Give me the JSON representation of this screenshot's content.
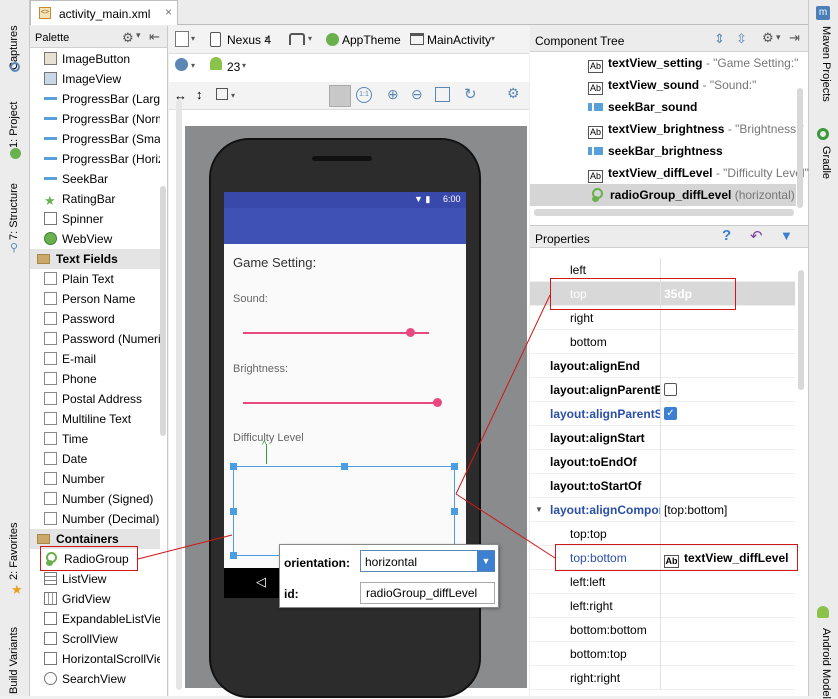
{
  "editor": {
    "tab_label": "activity_main.xml"
  },
  "left_strip": {
    "tabs": [
      "Captures",
      "1: Project",
      "7: Structure",
      "2: Favorites",
      "Build Variants"
    ]
  },
  "right_strip": {
    "tabs": [
      "Maven Projects",
      "Gradle",
      "Android Model"
    ]
  },
  "palette": {
    "title": "Palette",
    "items_top": [
      "ImageButton",
      "ImageView",
      "ProgressBar (Large)",
      "ProgressBar (Normal)",
      "ProgressBar (Small)",
      "ProgressBar (Horizontal)",
      "SeekBar",
      "RatingBar",
      "Spinner",
      "WebView"
    ],
    "group_text_fields": "Text Fields",
    "text_fields": [
      "Plain Text",
      "Person Name",
      "Password",
      "Password (Numeric)",
      "E-mail",
      "Phone",
      "Postal Address",
      "Multiline Text",
      "Time",
      "Date",
      "Number",
      "Number (Signed)",
      "Number (Decimal)"
    ],
    "group_containers": "Containers",
    "containers": [
      "RadioGroup",
      "ListView",
      "GridView",
      "ExpandableListView",
      "ScrollView",
      "HorizontalScrollView",
      "SearchView"
    ]
  },
  "toolbar": {
    "device": "Nexus 4",
    "theme": "AppTheme",
    "activity": "MainActivity",
    "api": "23"
  },
  "device_screen": {
    "time": "6:00",
    "title": "Game Setting:",
    "sound_label": "Sound:",
    "brightness_label": "Brightness:",
    "difficulty_label": "Difficulty Level",
    "sound_progress": 0.9,
    "brightness_progress": 0.95
  },
  "popup": {
    "orientation_label": "orientation:",
    "orientation_value": "horizontal",
    "id_label": "id:",
    "id_value": "radioGroup_diffLevel"
  },
  "component_tree": {
    "title": "Component Tree",
    "items": [
      {
        "icon": "Ab",
        "name": "textView_setting",
        "detail": "- \"Game Setting:\""
      },
      {
        "icon": "Ab",
        "name": "textView_sound",
        "detail": "- \"Sound:\""
      },
      {
        "icon": "seek",
        "name": "seekBar_sound",
        "detail": ""
      },
      {
        "icon": "Ab",
        "name": "textView_brightness",
        "detail": "- \"Brightness:\""
      },
      {
        "icon": "seek",
        "name": "seekBar_brightness",
        "detail": ""
      },
      {
        "icon": "Ab",
        "name": "textView_diffLevel",
        "detail": "- \"Difficulty Level\""
      },
      {
        "icon": "radio",
        "name": "radioGroup_diffLevel",
        "detail": "(horizontal)"
      }
    ]
  },
  "properties": {
    "title": "Properties",
    "rows": [
      {
        "name": "left",
        "value": "",
        "indent": true,
        "bold": false
      },
      {
        "name": "top",
        "value": "35dp",
        "indent": true,
        "bold": false,
        "selected": true
      },
      {
        "name": "right",
        "value": "",
        "indent": true,
        "bold": false
      },
      {
        "name": "bottom",
        "value": "",
        "indent": true,
        "bold": false
      },
      {
        "name": "layout:alignEnd",
        "value": "",
        "indent": false,
        "bold": true
      },
      {
        "name": "layout:alignParentEnd",
        "value": "checkbox-off",
        "indent": false,
        "bold": true
      },
      {
        "name": "layout:alignParentStart",
        "value": "checkbox-on",
        "indent": false,
        "bold": true,
        "blue": true
      },
      {
        "name": "layout:alignStart",
        "value": "",
        "indent": false,
        "bold": true
      },
      {
        "name": "layout:toEndOf",
        "value": "",
        "indent": false,
        "bold": true
      },
      {
        "name": "layout:toStartOf",
        "value": "",
        "indent": false,
        "bold": true
      },
      {
        "name": "layout:alignComponent",
        "value": "[top:bottom]",
        "indent": false,
        "bold": true,
        "blue": true,
        "expanded": true
      },
      {
        "name": "top:top",
        "value": "",
        "indent": true,
        "bold": false
      },
      {
        "name": "top:bottom",
        "value": "textView_diffLevel",
        "indent": true,
        "bold": false,
        "blue": true
      },
      {
        "name": "left:left",
        "value": "",
        "indent": true,
        "bold": false
      },
      {
        "name": "left:right",
        "value": "",
        "indent": true,
        "bold": false
      },
      {
        "name": "bottom:bottom",
        "value": "",
        "indent": true,
        "bold": false
      },
      {
        "name": "bottom:top",
        "value": "",
        "indent": true,
        "bold": false
      },
      {
        "name": "right:right",
        "value": "",
        "indent": true,
        "bold": false
      }
    ]
  },
  "colors": {
    "accent": "#3f51b5",
    "seekbar": "#e84880",
    "highlight": "#d01818",
    "selection": "#4a9de0"
  }
}
